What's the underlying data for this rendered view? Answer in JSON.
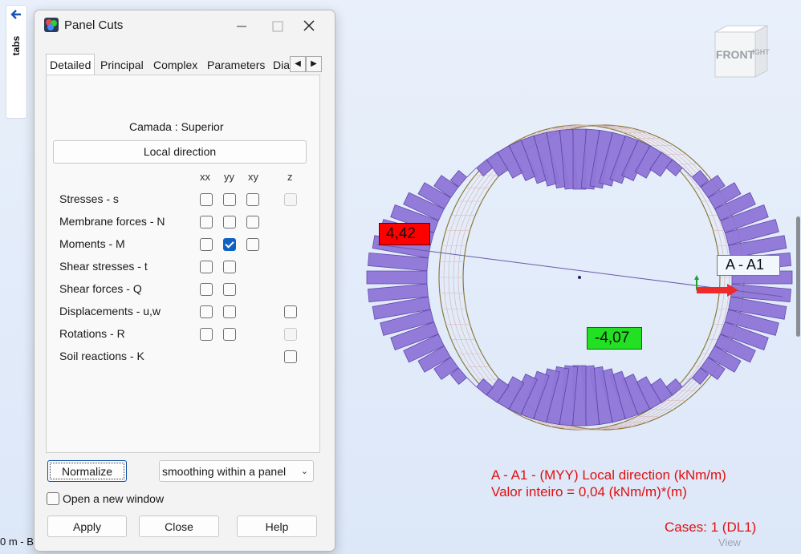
{
  "viewport": {
    "tabs_label": "tabs",
    "bottom_left_text": "0 m - B",
    "view_cube_front": "FRONT",
    "view_cube_right": "IGHT",
    "max_label": "4,42",
    "min_label": "-4,07",
    "section_label": "A - A1",
    "result_title": "A - A1 - (MYY) Local direction (kNm/m)",
    "result_scale": "Valor inteiro = 0,04 (kNm/m)*(m)",
    "cases": "Cases: 1 (DL1)",
    "view_label": "View",
    "colors": {
      "diagram_fill": "#8f76d8",
      "diagram_stroke": "#5a43a8",
      "max_badge": "#ff0000",
      "min_badge": "#22e022",
      "result_text": "#e01010"
    }
  },
  "dialog": {
    "title": "Panel Cuts",
    "controls": {
      "minimize": "minimize-icon",
      "maximize": "maximize-icon",
      "close": "close-icon"
    },
    "tabs": [
      {
        "label": "Detailed",
        "active": true
      },
      {
        "label": "Principal",
        "active": false
      },
      {
        "label": "Complex",
        "active": false
      },
      {
        "label": "Parameters",
        "active": false
      },
      {
        "label": "Dia",
        "active": false
      }
    ],
    "camada": "Camada : Superior",
    "direction_button": "Local direction",
    "columns": [
      "xx",
      "yy",
      "xy",
      "z"
    ],
    "rows": [
      {
        "label": "Stresses - s",
        "xx": "off",
        "yy": "off",
        "xy": "off",
        "z": "disabled"
      },
      {
        "label": "Membrane forces - N",
        "xx": "off",
        "yy": "off",
        "xy": "off",
        "z": null
      },
      {
        "label": "Moments - M",
        "xx": "off",
        "yy": "on",
        "xy": "off",
        "z": null
      },
      {
        "label": "Shear stresses - t",
        "xx": "off",
        "yy": "off",
        "xy": null,
        "z": null
      },
      {
        "label": "Shear forces - Q",
        "xx": "off",
        "yy": "off",
        "xy": null,
        "z": null
      },
      {
        "label": "Displacements - u,w",
        "xx": "off",
        "yy": "off",
        "xy": null,
        "z": "off"
      },
      {
        "label": "Rotations - R",
        "xx": "off",
        "yy": "off",
        "xy": null,
        "z": "disabled"
      },
      {
        "label": "Soil reactions - K",
        "xx": null,
        "yy": null,
        "xy": null,
        "z": "off"
      }
    ],
    "normalize_button": "Normalize",
    "smoothing_value": "smoothing within a panel",
    "open_new_window": "Open a new window",
    "open_new_window_checked": false,
    "apply_button": "Apply",
    "close_button": "Close",
    "help_button": "Help"
  }
}
